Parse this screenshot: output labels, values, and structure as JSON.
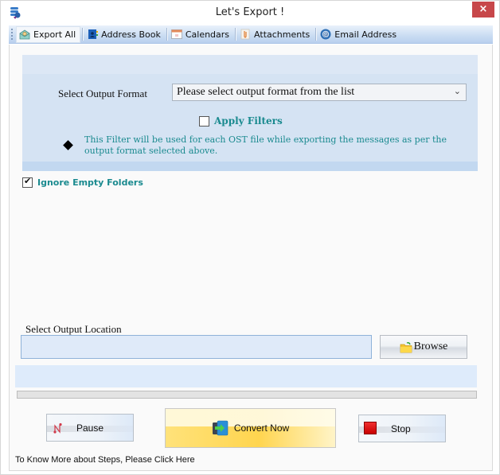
{
  "window": {
    "title": "Let's Export !",
    "close_label": "×"
  },
  "toolbar": {
    "tabs": [
      {
        "label": "Export All",
        "icon": "envelope-icon",
        "active": true
      },
      {
        "label": "Address Book",
        "icon": "address-book-icon",
        "active": false
      },
      {
        "label": "Calendars",
        "icon": "calendar-icon",
        "active": false
      },
      {
        "label": "Attachments",
        "icon": "paperclip-icon",
        "active": false
      },
      {
        "label": "Email Address",
        "icon": "at-sign-icon",
        "active": false
      }
    ]
  },
  "format": {
    "label": "Select Output Format",
    "selected": "Please select output format from the list",
    "chevron": "⌄"
  },
  "filters": {
    "apply_label": "Apply Filters",
    "apply_checked": false,
    "note": "This Filter will be used for each OST file while exporting the messages as per the output format selected above."
  },
  "options": {
    "ignore_empty_label": "Ignore Empty Folders",
    "ignore_empty_checked": true
  },
  "location": {
    "label": "Select Output Location",
    "value": "",
    "browse_label": "Browse"
  },
  "progress": {
    "percent": 0
  },
  "actions": {
    "pause_label": "Pause",
    "convert_label": "Convert Now",
    "stop_label": "Stop"
  },
  "help": {
    "link_text": "To Know More about Steps, Please Click Here"
  },
  "colors": {
    "accent_teal": "#1a8a8f",
    "close_red": "#c7474a",
    "panel_blue": "#d5e3f3",
    "convert_yellow": "#ffd54f",
    "stop_red": "#d40000"
  }
}
